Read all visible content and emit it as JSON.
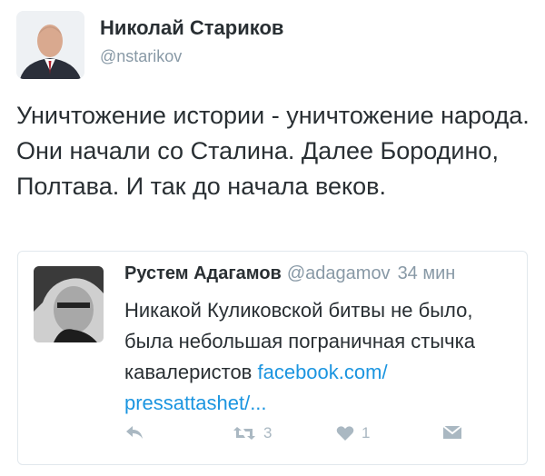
{
  "tweet": {
    "author_name": "Николай Стариков",
    "author_handle": "@nstarikov",
    "text": "Уничтожение истории - уничтожение народа. Они начали со Сталина. Далее Бородино, Полтава. И так до начала веков.",
    "avatar_icon": "user-avatar-photo"
  },
  "quoted": {
    "author_name": "Рустем Адагамов",
    "author_handle": "@adagamov",
    "time": "34 мин",
    "text": "Никакой Куликовской битвы не было, была небольшая пограничная стычка кавалеристов ",
    "link_text": "facebook.com/ pressattashet/...",
    "avatar_icon": "user-avatar-photo",
    "actions": {
      "reply_icon": "reply-icon",
      "retweet_icon": "retweet-icon",
      "retweet_count": "3",
      "like_icon": "heart-icon",
      "like_count": "1",
      "message_icon": "direct-message-icon"
    }
  },
  "colors": {
    "text": "#292f33",
    "secondary": "#8899a6",
    "link": "#1b95e0",
    "icon": "#aab8c2",
    "border": "#e1e8ed"
  }
}
